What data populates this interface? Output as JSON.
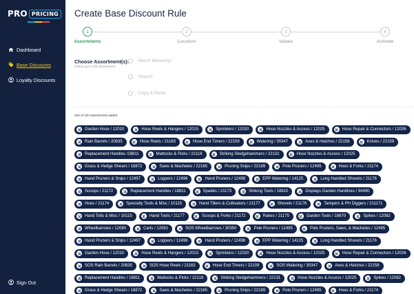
{
  "brand": {
    "pro": "PRO",
    "pricing": "PRICING"
  },
  "sidebar": {
    "items": [
      {
        "label": "Dashboard",
        "icon": "home-icon",
        "active": false
      },
      {
        "label": "Base Discounts",
        "icon": "tag-icon",
        "active": true
      },
      {
        "label": "Loyalty Discounts",
        "icon": "person-icon",
        "active": false
      }
    ],
    "signout": "Sign Out"
  },
  "page": {
    "title": "Create Base Discount Rule"
  },
  "stepper": {
    "steps": [
      {
        "number": "1",
        "label": "Assortments",
        "active": true
      },
      {
        "number": "2",
        "label": "Location",
        "active": false
      },
      {
        "number": "3",
        "label": "Values",
        "active": false
      },
      {
        "number": "4",
        "label": "Activate",
        "active": false
      }
    ]
  },
  "assortment": {
    "label": "Choose Assortment(s):",
    "sub": "Select up to 100 assortments",
    "options": [
      "Merch Hierarchy:",
      "Search:",
      "Copy & Paste:"
    ],
    "count_text": "100 of 100 assortments added"
  },
  "chips": [
    [
      "Garden Hose / 12010",
      "Hose Reels & Hangers / 12015",
      "Sprinklers / 12020",
      "Hose Nozzles & Access / 12025",
      "Hose Repair & Connectors / 12026"
    ],
    [
      "Rain Barrels / 20835",
      "Hose Reels / 21163",
      "Hose End Timers / 22109",
      "Watering / 30347",
      "Axes & Hatches / 22158",
      "Knives / 22159"
    ],
    [
      "Replacement Handles /18811",
      "Mattocks & Picks / 22118",
      "Striking Sledgehammers / 22131",
      "Hose Nozzles & Access / 12025"
    ],
    [
      "Grass & Hedge Shears / 18872",
      "Saws & Machetes / 22165",
      "Pruning Snips / 22189",
      "Pole Pruners / 12495",
      "Hoes & Forks / 21174"
    ],
    [
      "Hand Pruners & Snips / 12497",
      "Loppers / 12496",
      "Hand Pruners / 12498",
      "EPP Watering / 14125",
      "Long Handled Shovels / 21176"
    ],
    [
      "Scoops / 21172",
      "Replacement Handles / 18811",
      "Spades / 21173",
      "Striking Tools / 18810",
      "Displays Garden Hardlines / 94490"
    ],
    [
      "Hoes / 21174",
      "Specialty Tools & Misc / 10115",
      "Hand Tillers & Cultivators / 21177",
      "Shovels / 21176",
      "Tampers & PH Diggers / 211171"
    ],
    [
      "Hand Tolls & Misc / 10115",
      "Hand Tools / 21177",
      "Scoops & Forks / 21172",
      "Rakes / 21175",
      "Garden Tools / 18870",
      "Spikes / 12082"
    ],
    [
      "Wheelbarrows / 12080",
      "Carts / 12081",
      "SOS Wheelbarrows / 30350",
      "Pole Pruners / 12495",
      "Pole Pruners, Saws, & Machetes / 12495"
    ],
    [
      "Hand Pruners & Snips / 12497",
      "Loppers / 12496",
      "Hand Pruners / 12498",
      "EPP Watering / 14125",
      "Long Handled Shovels / 21176"
    ],
    [
      "Garden Hose / 12010",
      "Hose Reels & Hangers / 12015",
      "Sprinklers / 12020",
      "Hose Nozzles & Access / 12025",
      "Hose Repair & Connectors / 12026"
    ],
    [
      "SOS Rain Barrels / 20835",
      "SOS Hose Reels / 21163",
      "Hose End Timers / 22109",
      "SOS Watering / 30347",
      "Axes & Hatches / 22158"
    ],
    [
      "Replacement Handles / 18811",
      "Mattocks & Picks / 22118",
      "Striking Sledgehammers / 22131",
      "Hose Nozzles & Access / 12025",
      "Spikes / 12082"
    ],
    [
      "Grass & Hedge Shears / 18872",
      "Saws & Machetes / 22165",
      "Pruning Snips / 22189",
      "Pole Pruners / 12495",
      "Hoes & Forks / 21174"
    ]
  ],
  "colors": {
    "sidebar": "#13213f",
    "chip": "#14254a",
    "active_nav": "#f1c40f",
    "step_active": "#2e9b5e"
  }
}
